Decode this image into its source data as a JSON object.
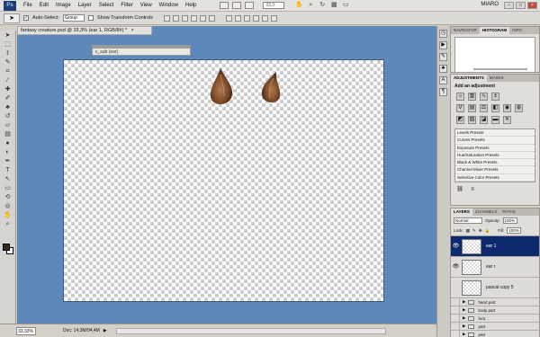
{
  "app": {
    "logo": "Ps",
    "menu": [
      "File",
      "Edit",
      "Image",
      "Layer",
      "Select",
      "Filter",
      "View",
      "Window",
      "Help"
    ],
    "zoom_field": "33,3",
    "workspace": "MIARO"
  },
  "options": {
    "auto_select_label": "Auto-Select:",
    "auto_select_value": "Group",
    "transform_label": "Show Transform Controls"
  },
  "document": {
    "tab_title": "fantasy creature.psd @ 33,3% (ear 1, RGB/8#) *",
    "tab_close": "×",
    "floating_label": "c_sub (ear)"
  },
  "status": {
    "zoom": "33,33%",
    "doc_size": "Doc: 14,3M/94,4M"
  },
  "navigator_panel": {
    "tabs": [
      "NAVIGATOR",
      "HISTOGRAM",
      "INFO"
    ],
    "active_tab": "HISTOGRAM"
  },
  "adjustments_panel": {
    "tabs": [
      "ADJUSTMENTS",
      "MASKS"
    ],
    "title": "Add an adjustment",
    "presets": [
      "Levels Presets",
      "Curves Presets",
      "Exposure Presets",
      "Hue/Saturation Presets",
      "Black & White Presets",
      "Channel Mixer Presets",
      "Selective Color Presets"
    ]
  },
  "layers_panel": {
    "tabs": [
      "LAYERS",
      "CHANNELS",
      "PATHS"
    ],
    "blend_mode": "Normal",
    "opacity_label": "Opacity:",
    "opacity_value": "100%",
    "lock_label": "Lock:",
    "fill_label": "Fill:",
    "fill_value": "100%",
    "layers": [
      {
        "name": "ear 1",
        "selected": true,
        "visible": true
      },
      {
        "name": "ear r",
        "selected": false,
        "visible": true
      },
      {
        "name": "pascal copy 5",
        "selected": false,
        "visible": false
      }
    ],
    "groups": [
      "hand part",
      "body part",
      "foot",
      "part",
      "part"
    ]
  },
  "colors": {
    "workspace_bg": "#5f88ba",
    "selected_layer": "#0e2a6e",
    "ear_brown": "#7a4a2a"
  }
}
